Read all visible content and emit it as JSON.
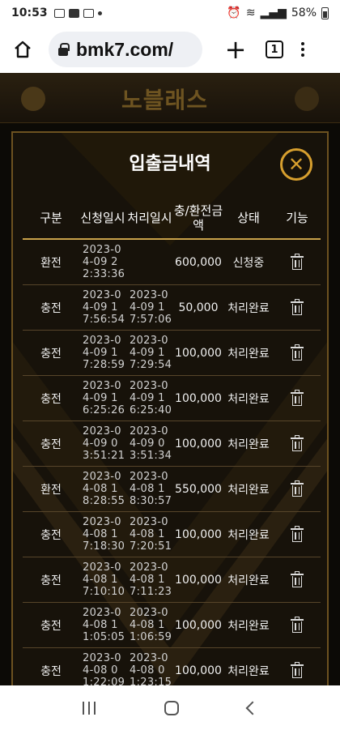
{
  "status_bar": {
    "time": "10:53",
    "battery": "58%"
  },
  "browser": {
    "url": "bmk7.com/",
    "tab_count": "1"
  },
  "site": {
    "logo": "노블래스"
  },
  "modal": {
    "title": "입출금내역",
    "headers": [
      "구분",
      "신청일시",
      "처리일시",
      "충/환전금액",
      "상태",
      "기능"
    ],
    "rows": [
      {
        "type": "환전",
        "request": "2023-04-09 22:33:36",
        "processed": "",
        "amount": "600,000",
        "status": "신청중"
      },
      {
        "type": "충전",
        "request": "2023-04-09 17:56:54",
        "processed": "2023-04-09 17:57:06",
        "amount": "50,000",
        "status": "처리완료"
      },
      {
        "type": "충전",
        "request": "2023-04-09 17:28:59",
        "processed": "2023-04-09 17:29:54",
        "amount": "100,000",
        "status": "처리완료"
      },
      {
        "type": "충전",
        "request": "2023-04-09 16:25:26",
        "processed": "2023-04-09 16:25:40",
        "amount": "100,000",
        "status": "처리완료"
      },
      {
        "type": "충전",
        "request": "2023-04-09 03:51:21",
        "processed": "2023-04-09 03:51:34",
        "amount": "100,000",
        "status": "처리완료"
      },
      {
        "type": "환전",
        "request": "2023-04-08 18:28:55",
        "processed": "2023-04-08 18:30:57",
        "amount": "550,000",
        "status": "처리완료"
      },
      {
        "type": "충전",
        "request": "2023-04-08 17:18:30",
        "processed": "2023-04-08 17:20:51",
        "amount": "100,000",
        "status": "처리완료"
      },
      {
        "type": "충전",
        "request": "2023-04-08 17:10:10",
        "processed": "2023-04-08 17:11:23",
        "amount": "100,000",
        "status": "처리완료"
      },
      {
        "type": "충전",
        "request": "2023-04-08 11:05:05",
        "processed": "2023-04-08 11:06:59",
        "amount": "100,000",
        "status": "처리완료"
      },
      {
        "type": "충전",
        "request": "2023-04-08 01:22:09",
        "processed": "2023-04-08 01:23:15",
        "amount": "100,000",
        "status": "처리완료"
      }
    ]
  },
  "colors": {
    "accent": "#d79f2e",
    "border": "#6d5220",
    "bg": "#1a1408"
  },
  "icons": {
    "delete": "trash-icon",
    "close": "close-icon"
  }
}
